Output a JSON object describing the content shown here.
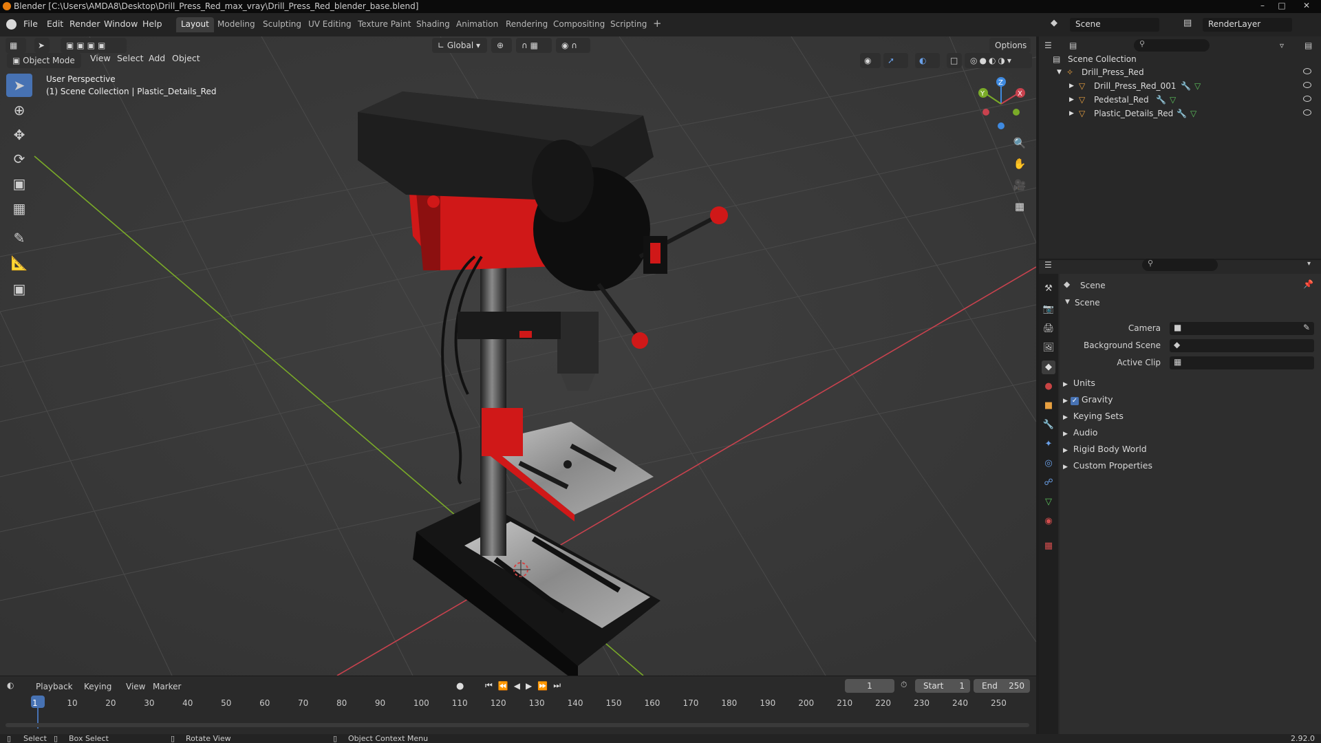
{
  "window": {
    "title": "Blender [C:\\Users\\AMDA8\\Desktop\\Drill_Press_Red_max_vray\\Drill_Press_Red_blender_base.blend]"
  },
  "menu": [
    "File",
    "Edit",
    "Render",
    "Window",
    "Help"
  ],
  "workspaces": [
    "Layout",
    "Modeling",
    "Sculpting",
    "UV Editing",
    "Texture Paint",
    "Shading",
    "Animation",
    "Rendering",
    "Compositing",
    "Scripting"
  ],
  "workspace_add": "+",
  "scene_name": "Scene",
  "view_layer": "RenderLayer",
  "viewport": {
    "mode": "Object Mode",
    "menus": [
      "View",
      "Select",
      "Add",
      "Object"
    ],
    "transform_orientation": "Global",
    "options_label": "Options",
    "overlay_line1": "User Perspective",
    "overlay_line2": "(1) Scene Collection | Plastic_Details_Red",
    "gizmo_axes": {
      "x": "X",
      "y": "Y",
      "z": "Z"
    }
  },
  "timeline": {
    "menus": [
      "Playback",
      "Keying",
      "View",
      "Marker"
    ],
    "current_frame": "1",
    "start_label": "Start",
    "start_value": "1",
    "end_label": "End",
    "end_value": "250",
    "ticks": [
      "1",
      "10",
      "20",
      "30",
      "40",
      "50",
      "60",
      "70",
      "80",
      "90",
      "100",
      "110",
      "120",
      "130",
      "140",
      "150",
      "160",
      "170",
      "180",
      "190",
      "200",
      "210",
      "220",
      "230",
      "240",
      "250"
    ]
  },
  "outliner": {
    "root": "Scene Collection",
    "collection": "Drill_Press_Red",
    "objects": [
      "Drill_Press_Red_001",
      "Pedestal_Red",
      "Plastic_Details_Red"
    ]
  },
  "properties": {
    "context_title": "Scene",
    "panel_title": "Scene",
    "fields": {
      "camera": "Camera",
      "background_scene": "Background Scene",
      "active_clip": "Active Clip"
    },
    "subpanels": [
      "Units",
      "Gravity",
      "Keying Sets",
      "Audio",
      "Rigid Body World",
      "Custom Properties"
    ]
  },
  "statusbar": {
    "select": "Select",
    "box_select": "Box Select",
    "rotate_view": "Rotate View",
    "context_menu": "Object Context Menu",
    "version": "2.92.0"
  },
  "colors": {
    "accent": "#4772b3",
    "axis_x": "#c8424e",
    "axis_y": "#7aab28",
    "axis_z": "#3f8ae0",
    "body_red": "#d01818"
  }
}
